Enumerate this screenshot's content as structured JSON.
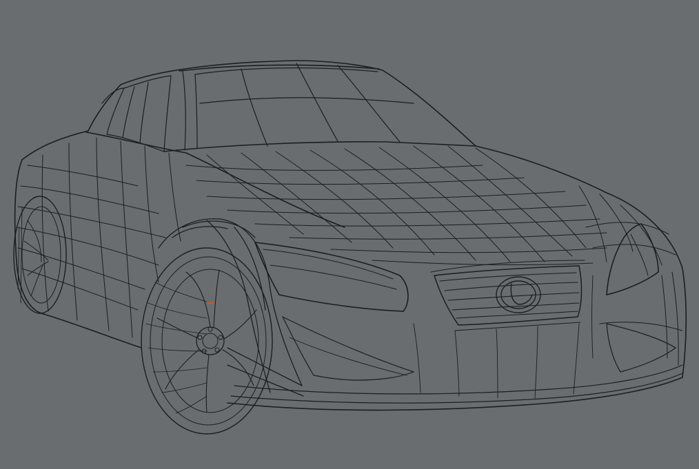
{
  "viewport": {
    "background": "#696d70",
    "wire_color": "#1c1d1e",
    "selection_color": "#d2561f"
  }
}
